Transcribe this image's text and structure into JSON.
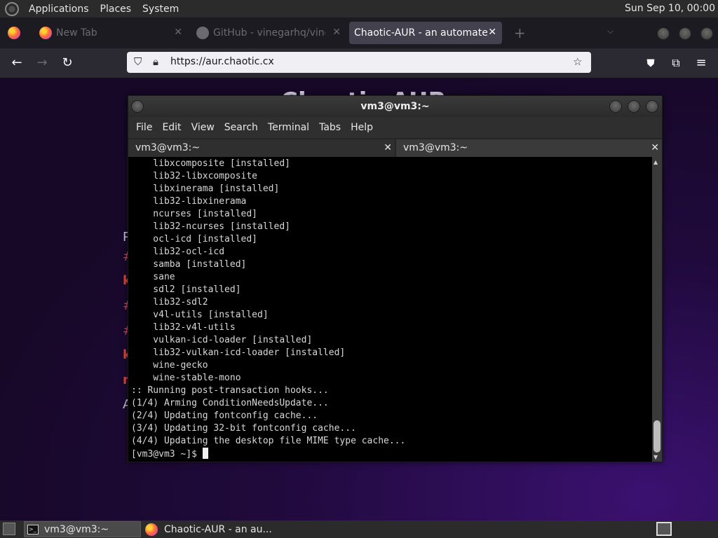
{
  "top_panel": {
    "menus": [
      "Applications",
      "Places",
      "System"
    ],
    "clock": "Sun Sep 10, 00:00"
  },
  "browser": {
    "tabs": [
      {
        "label": "New Tab"
      },
      {
        "label": "GitHub - vinegarhq/vinegar"
      },
      {
        "label": "Chaotic-AUR - an automated bu"
      }
    ],
    "new_tab_symbol": "+",
    "url": "https://aur.chaotic.cx"
  },
  "page": {
    "heading": "Chaotic-AUR",
    "fragments": [
      {
        "text": "P",
        "color": "#c9c3d6"
      },
      {
        "text": "#",
        "color": "#d44a4a"
      },
      {
        "text": "k",
        "color": "#e0452f"
      },
      {
        "text": "#",
        "color": "#d44a4a"
      },
      {
        "text": "#",
        "color": "#d44a4a"
      },
      {
        "text": "k",
        "color": "#e0452f"
      },
      {
        "text": "n",
        "color": "#e0452f"
      },
      {
        "text": "A",
        "color": "#c9c3d6"
      }
    ]
  },
  "terminal": {
    "title": "vm3@vm3:~",
    "menus": [
      "File",
      "Edit",
      "View",
      "Search",
      "Terminal",
      "Tabs",
      "Help"
    ],
    "tabs": [
      {
        "label": "vm3@vm3:~"
      },
      {
        "label": "vm3@vm3:~"
      }
    ],
    "lines": [
      "    libxcomposite [installed]",
      "    lib32-libxcomposite",
      "    libxinerama [installed]",
      "    lib32-libxinerama",
      "    ncurses [installed]",
      "    lib32-ncurses [installed]",
      "    ocl-icd [installed]",
      "    lib32-ocl-icd",
      "    samba [installed]",
      "    sane",
      "    sdl2 [installed]",
      "    lib32-sdl2",
      "    v4l-utils [installed]",
      "    lib32-v4l-utils",
      "    vulkan-icd-loader [installed]",
      "    lib32-vulkan-icd-loader [installed]",
      "    wine-gecko",
      "    wine-stable-mono",
      ":: Running post-transaction hooks...",
      "(1/4) Arming ConditionNeedsUpdate...",
      "(2/4) Updating fontconfig cache...",
      "(3/4) Updating 32-bit fontconfig cache...",
      "(4/4) Updating the desktop file MIME type cache..."
    ],
    "prompt": "[vm3@vm3 ~]$ "
  },
  "bottom_panel": {
    "tasks": [
      {
        "label": "vm3@vm3:~"
      },
      {
        "label": "Chaotic-AUR - an au..."
      }
    ]
  }
}
